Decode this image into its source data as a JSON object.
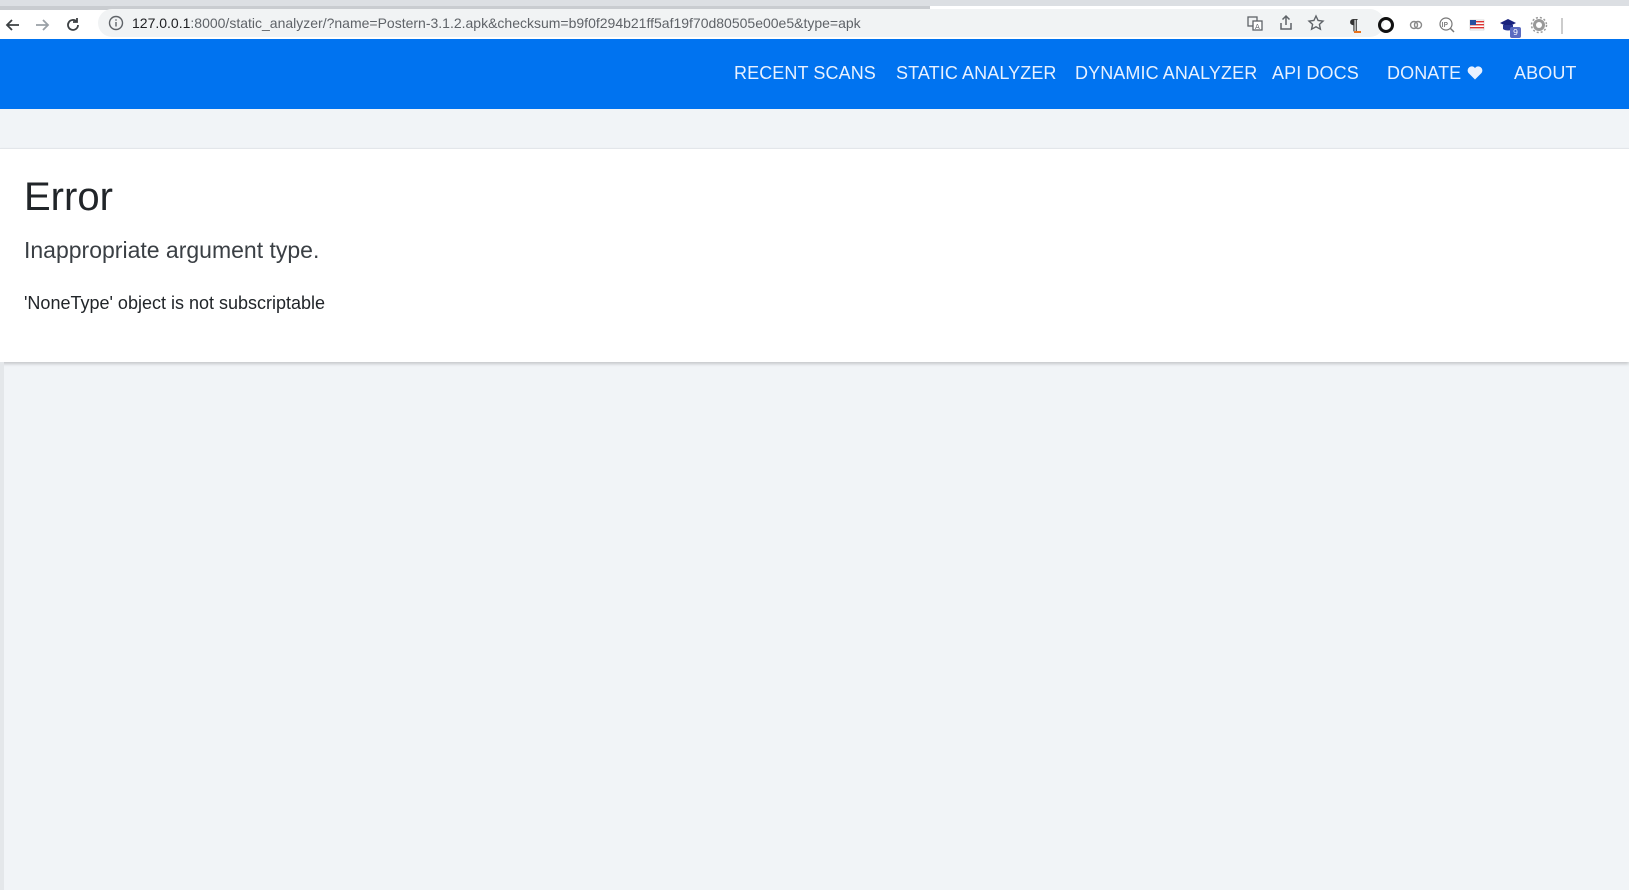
{
  "browser": {
    "url_host": "127.0.0.1",
    "url_rest": ":8000/static_analyzer/?name=Postern-3.1.2.apk&checksum=b9f0f294b21ff5af19f70d80505e00e5&type=apk",
    "icons": [
      "back-icon",
      "forward-icon",
      "reload-icon",
      "info-icon",
      "translate-icon",
      "share-icon",
      "star-icon",
      "pilcrow-icon",
      "circle-icon",
      "link-icon",
      "ip-icon",
      "flag-icon",
      "graduation-cap-icon",
      "gear-icon"
    ],
    "extension_badge": "9",
    "ip_label": "IP"
  },
  "navbar": {
    "links": [
      "RECENT SCANS",
      "STATIC ANALYZER",
      "DYNAMIC ANALYZER",
      "API DOCS",
      "DONATE",
      "ABOUT"
    ],
    "background_color": "#0073f0"
  },
  "error": {
    "title": "Error",
    "subtitle": "Inappropriate argument type.",
    "detail": "'NoneType' object is not subscriptable"
  }
}
